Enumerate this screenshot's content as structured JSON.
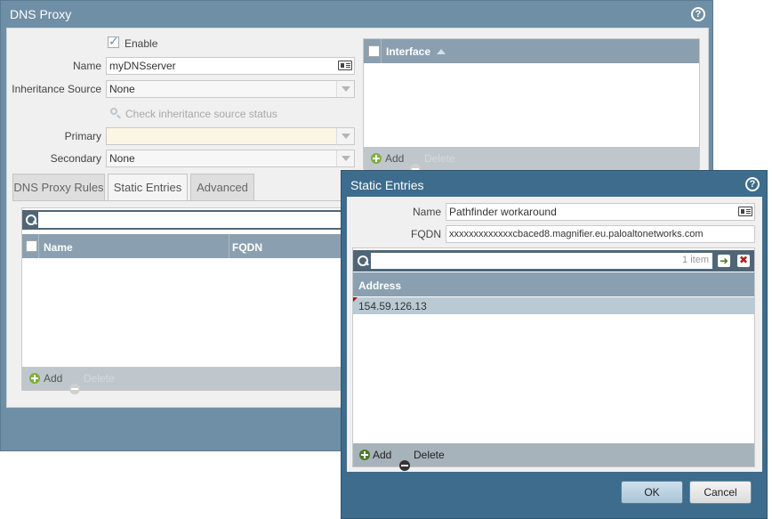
{
  "dns_proxy": {
    "title": "DNS Proxy",
    "help": "?",
    "enable_label": "Enable",
    "enable_checked": true,
    "name_label": "Name",
    "name_value": "myDNSserver",
    "inheritance_label": "Inheritance Source",
    "inheritance_value": "None",
    "check_inheritance": "Check inheritance source status",
    "primary_label": "Primary",
    "primary_value": "",
    "secondary_label": "Secondary",
    "secondary_value": "None",
    "interface_header": "Interface",
    "interface_add": "Add",
    "interface_delete": "Delete",
    "tabs": [
      {
        "label": "DNS Proxy Rules"
      },
      {
        "label": "Static Entries"
      },
      {
        "label": "Advanced"
      }
    ],
    "entries_columns": [
      "Name",
      "FQDN"
    ],
    "entries_add": "Add",
    "entries_delete": "Delete"
  },
  "static_entries": {
    "title": "Static Entries",
    "help": "?",
    "name_label": "Name",
    "name_value": "Pathfinder workaround",
    "fqdn_label": "FQDN",
    "fqdn_value": "xxxxxxxxxxxxxcbaced8.magnifier.eu.paloaltonetworks.com",
    "search_count": "1 item",
    "address_header": "Address",
    "addresses": [
      "154.59.126.13"
    ],
    "add_label": "Add",
    "delete_label": "Delete",
    "ok_label": "OK",
    "cancel_label": "Cancel"
  },
  "colors": {
    "dialog_bg": "#6f8fa6",
    "active_dialog_bg": "#3d6c8c",
    "grid_header": "#8aa0b0",
    "add_icon": "#7fae3f"
  }
}
